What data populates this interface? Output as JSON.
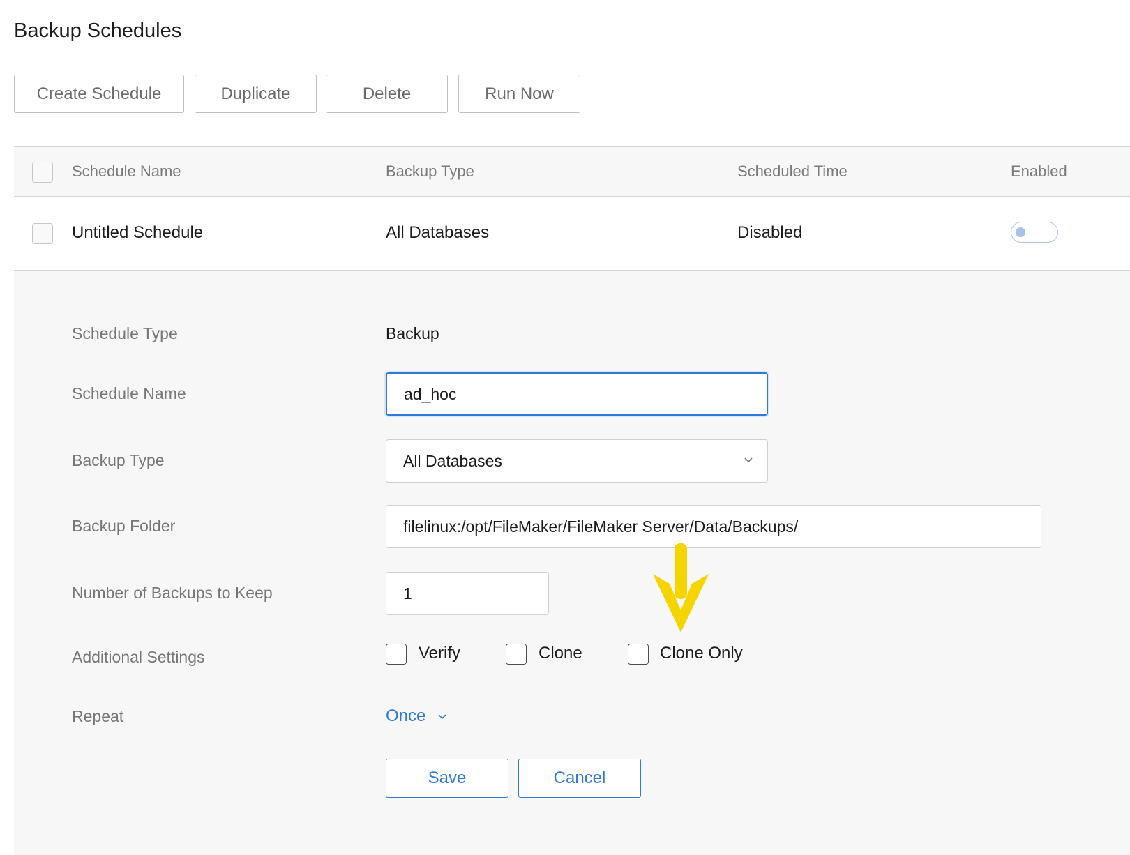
{
  "page": {
    "title": "Backup Schedules"
  },
  "toolbar": {
    "create_label": "Create Schedule",
    "duplicate_label": "Duplicate",
    "delete_label": "Delete",
    "run_now_label": "Run Now"
  },
  "table": {
    "columns": {
      "name": "Schedule Name",
      "type": "Backup Type",
      "time": "Scheduled Time",
      "enabled": "Enabled"
    },
    "rows": [
      {
        "name": "Untitled Schedule",
        "type": "All Databases",
        "time": "Disabled",
        "enabled": false
      }
    ]
  },
  "details": {
    "schedule_type_label": "Schedule Type",
    "schedule_type_value": "Backup",
    "schedule_name_label": "Schedule Name",
    "schedule_name_value": "ad_hoc",
    "backup_type_label": "Backup Type",
    "backup_type_value": "All Databases",
    "backup_folder_label": "Backup Folder",
    "backup_folder_value": "filelinux:/opt/FileMaker/FileMaker Server/Data/Backups/",
    "keep_label": "Number of Backups to Keep",
    "keep_value": "1",
    "additional_label": "Additional Settings",
    "options": {
      "verify": "Verify",
      "clone": "Clone",
      "clone_only": "Clone Only"
    },
    "repeat_label": "Repeat",
    "repeat_value": "Once",
    "save_label": "Save",
    "cancel_label": "Cancel"
  },
  "colors": {
    "accent": "#2f79d9",
    "annotation_arrow": "#f5d400",
    "panel_bg": "#f7f7f7"
  },
  "icons": {
    "select_chevron": "chevron-down-icon",
    "repeat_chevron": "chevron-down-icon",
    "annotation": "arrow-down-icon"
  }
}
